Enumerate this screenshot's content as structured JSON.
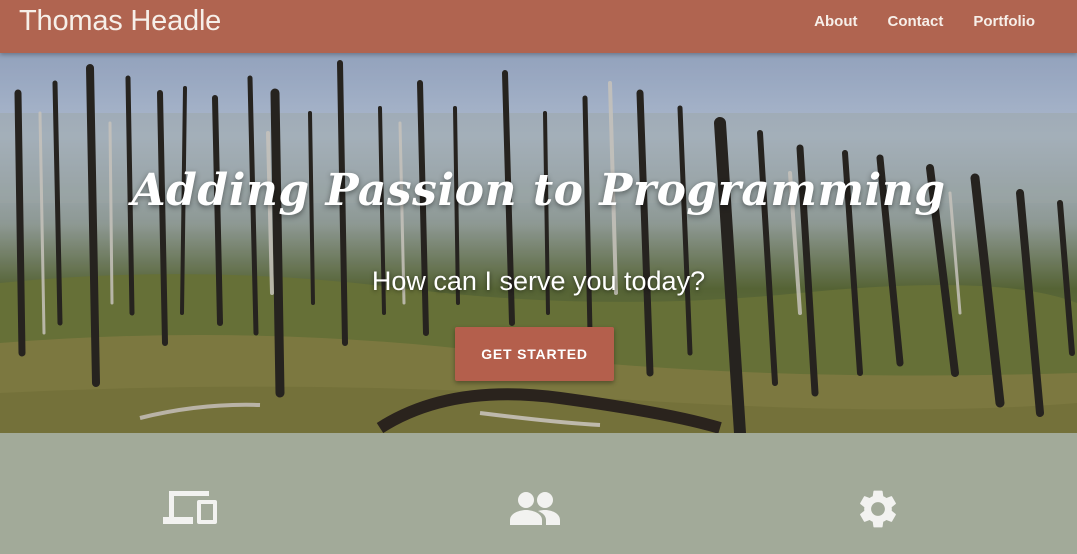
{
  "navbar": {
    "brand": "Thomas Headle",
    "links": [
      "About",
      "Contact",
      "Portfolio"
    ]
  },
  "hero": {
    "title": "Adding Passion to Programming",
    "subtitle": "How can I serve you today?",
    "cta_label": "GET STARTED"
  },
  "features": {
    "icons": [
      "devices-icon",
      "people-icon",
      "gear-icon"
    ]
  },
  "colors": {
    "navbar": "#b06450",
    "cta": "#b45f4c",
    "features_bg": "#a2aa99",
    "icon": "#f2f2f0"
  }
}
